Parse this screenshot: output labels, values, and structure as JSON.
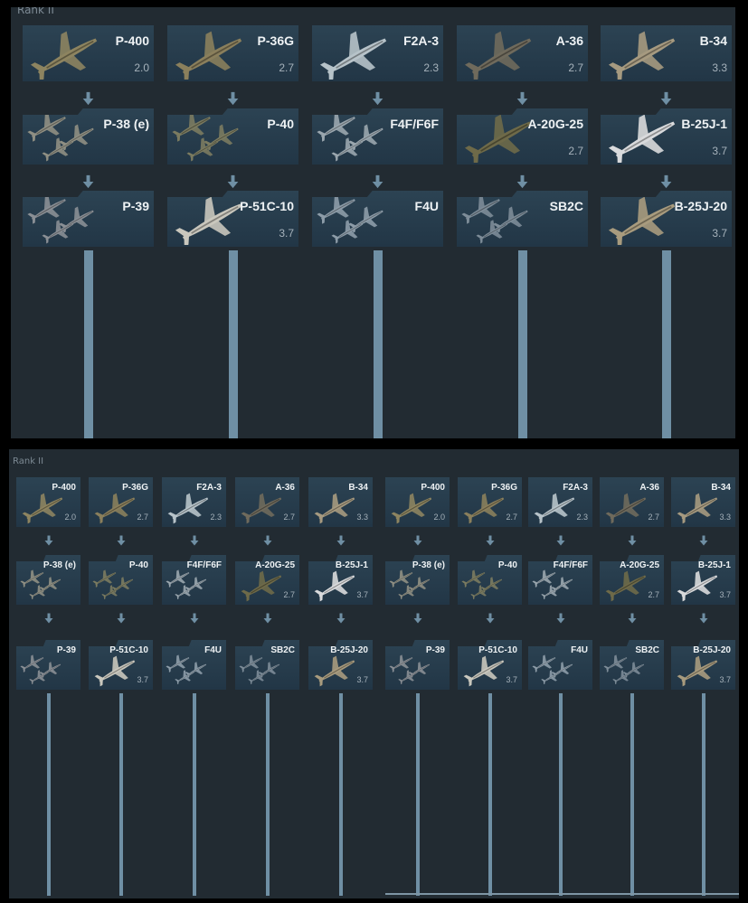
{
  "rank_label": "Rank II",
  "columns": [
    {
      "cards": [
        {
          "name": "P-400",
          "br": "2.0",
          "icon": "plane-icon",
          "tone": "#8d8460"
        },
        {
          "name": "P-38 (e)",
          "br": "",
          "icon": "group-icon",
          "tone": "#8f8f83"
        },
        {
          "name": "P-39",
          "br": "",
          "icon": "group-icon",
          "tone": "#8a8f95"
        }
      ]
    },
    {
      "cards": [
        {
          "name": "P-36G",
          "br": "2.7",
          "icon": "plane-icon",
          "tone": "#8a7f5c"
        },
        {
          "name": "P-40",
          "br": "",
          "icon": "group-icon",
          "tone": "#7b7b60"
        },
        {
          "name": "P-51C-10",
          "br": "3.7",
          "icon": "plane-icon",
          "tone": "#c9c7bd"
        }
      ]
    },
    {
      "cards": [
        {
          "name": "F2A-3",
          "br": "2.3",
          "icon": "plane-icon",
          "tone": "#b7c3c9"
        },
        {
          "name": "F4F/F6F",
          "br": "",
          "icon": "group-icon",
          "tone": "#9aa6ae"
        },
        {
          "name": "F4U",
          "br": "",
          "icon": "group-icon",
          "tone": "#8d9ca8"
        }
      ]
    },
    {
      "cards": [
        {
          "name": "A-36",
          "br": "2.7",
          "icon": "plane-icon",
          "tone": "#6f6a5c"
        },
        {
          "name": "A-20G-25",
          "br": "2.7",
          "icon": "plane-icon",
          "tone": "#6e6a49"
        },
        {
          "name": "SB2C",
          "br": "",
          "icon": "group-icon",
          "tone": "#7d8c98"
        }
      ]
    },
    {
      "cards": [
        {
          "name": "B-34",
          "br": "3.3",
          "icon": "plane-icon",
          "tone": "#a69a80"
        },
        {
          "name": "B-25J-1",
          "br": "3.7",
          "icon": "plane-icon",
          "tone": "#d9dadc"
        },
        {
          "name": "B-25J-20",
          "br": "3.7",
          "icon": "plane-icon",
          "tone": "#a89b7e"
        }
      ]
    }
  ],
  "colors": {
    "panel_bg": "#222b32",
    "card_bg": "#2c4353",
    "connector": "#6f8fa4",
    "label_text": "#eef2f4",
    "br_text": "#a6b2bb"
  }
}
